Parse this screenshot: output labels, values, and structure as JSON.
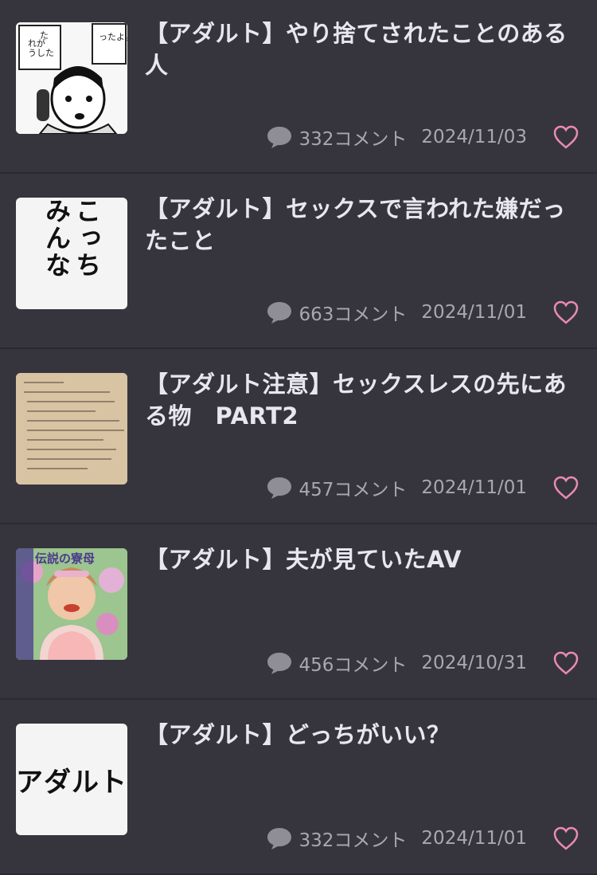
{
  "items": [
    {
      "title": "【アダルト】やり捨てされたことのある人",
      "comments": "332コメント",
      "date": "2024/11/03",
      "thumb_text": ""
    },
    {
      "title": "【アダルト】セックスで言われた嫌だったこと",
      "comments": "663コメント",
      "date": "2024/11/01",
      "thumb_text": "こっち みんな"
    },
    {
      "title": "【アダルト注意】セックスレスの先にある物　PART2",
      "comments": "457コメント",
      "date": "2024/11/01",
      "thumb_text": ""
    },
    {
      "title": "【アダルト】夫が見ていたAV",
      "comments": "456コメント",
      "date": "2024/10/31",
      "thumb_text": "伝説の寮母"
    },
    {
      "title": "【アダルト】どっちがいい？",
      "comments": "332コメント",
      "date": "2024/11/01",
      "thumb_text": "アダルト"
    }
  ],
  "colors": {
    "background": "#36353d",
    "heart": "#e98bb0",
    "meta": "#a9a7b0"
  },
  "icons": {
    "comment": "speech-bubble-icon",
    "like": "heart-outline-icon"
  }
}
